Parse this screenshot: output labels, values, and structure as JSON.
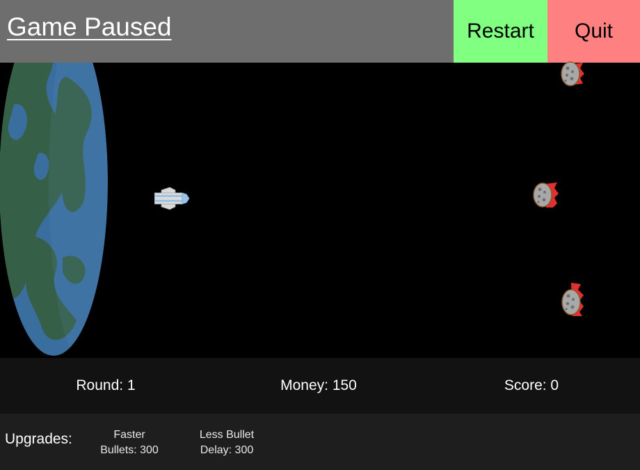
{
  "header": {
    "title": "Game Paused",
    "restart_label": "Restart",
    "quit_label": "Quit",
    "restart_color": "#80ff80",
    "quit_color": "#ff8080"
  },
  "stats": {
    "round": "Round: 1",
    "money": "Money: 150",
    "score": "Score: 0"
  },
  "upgrades": {
    "label": "Upgrades:",
    "items": [
      {
        "line1": "Faster",
        "line2": "Bullets: 300"
      },
      {
        "line1": "Less Bullet",
        "line2": "Delay: 300"
      }
    ]
  },
  "scene": {
    "planet": "earth",
    "player": "spaceship-icon",
    "enemies": [
      "asteroid-icon",
      "asteroid-icon",
      "asteroid-icon"
    ],
    "colors": {
      "ocean": "#3a6e9e",
      "land": "#355f46",
      "background": "#000000"
    }
  }
}
